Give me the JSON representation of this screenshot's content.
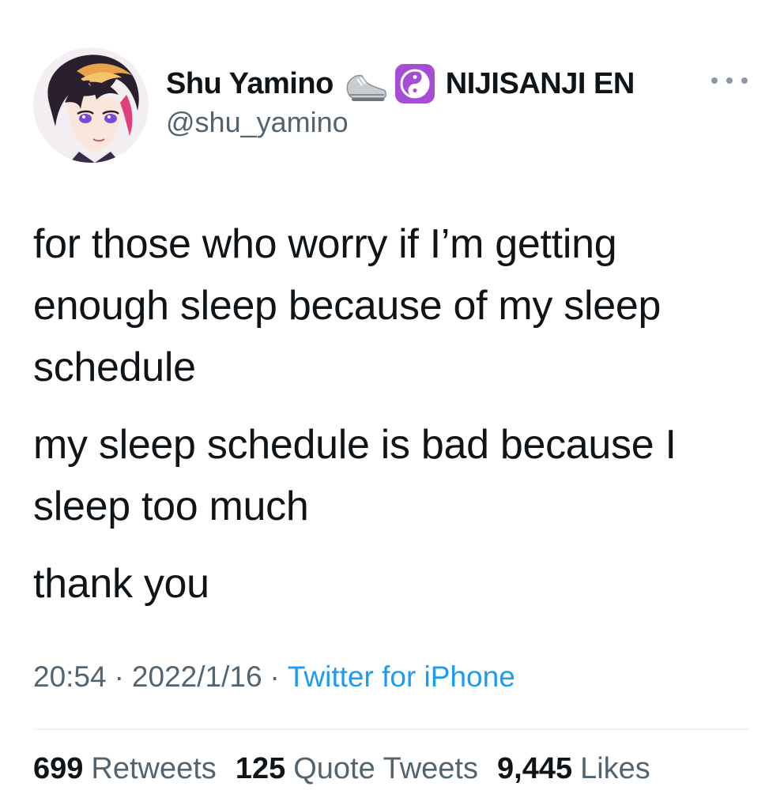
{
  "user": {
    "display_name": "Shu Yamino",
    "affiliation": "NIJISANJI EN",
    "handle": "@shu_yamino",
    "icons": [
      "running-shoe-icon",
      "yin-yang-badge-icon"
    ]
  },
  "tweet": {
    "paragraphs": [
      "for those who worry if I’m getting enough sleep because of my sleep schedule",
      "my sleep schedule is bad because I sleep too much",
      "thank you"
    ],
    "time": "20:54",
    "date": "2022/1/16",
    "separator": "·",
    "source": "Twitter for iPhone"
  },
  "stats": {
    "retweets": {
      "count": "699",
      "label": "Retweets"
    },
    "quote_tweets": {
      "count": "125",
      "label": "Quote Tweets"
    },
    "likes": {
      "count": "9,445",
      "label": "Likes"
    }
  },
  "colors": {
    "text": "#0f1419",
    "secondary": "#536471",
    "link": "#1d9bf0",
    "divider": "#eff3f4",
    "badge_purple": "#a64dd6"
  }
}
